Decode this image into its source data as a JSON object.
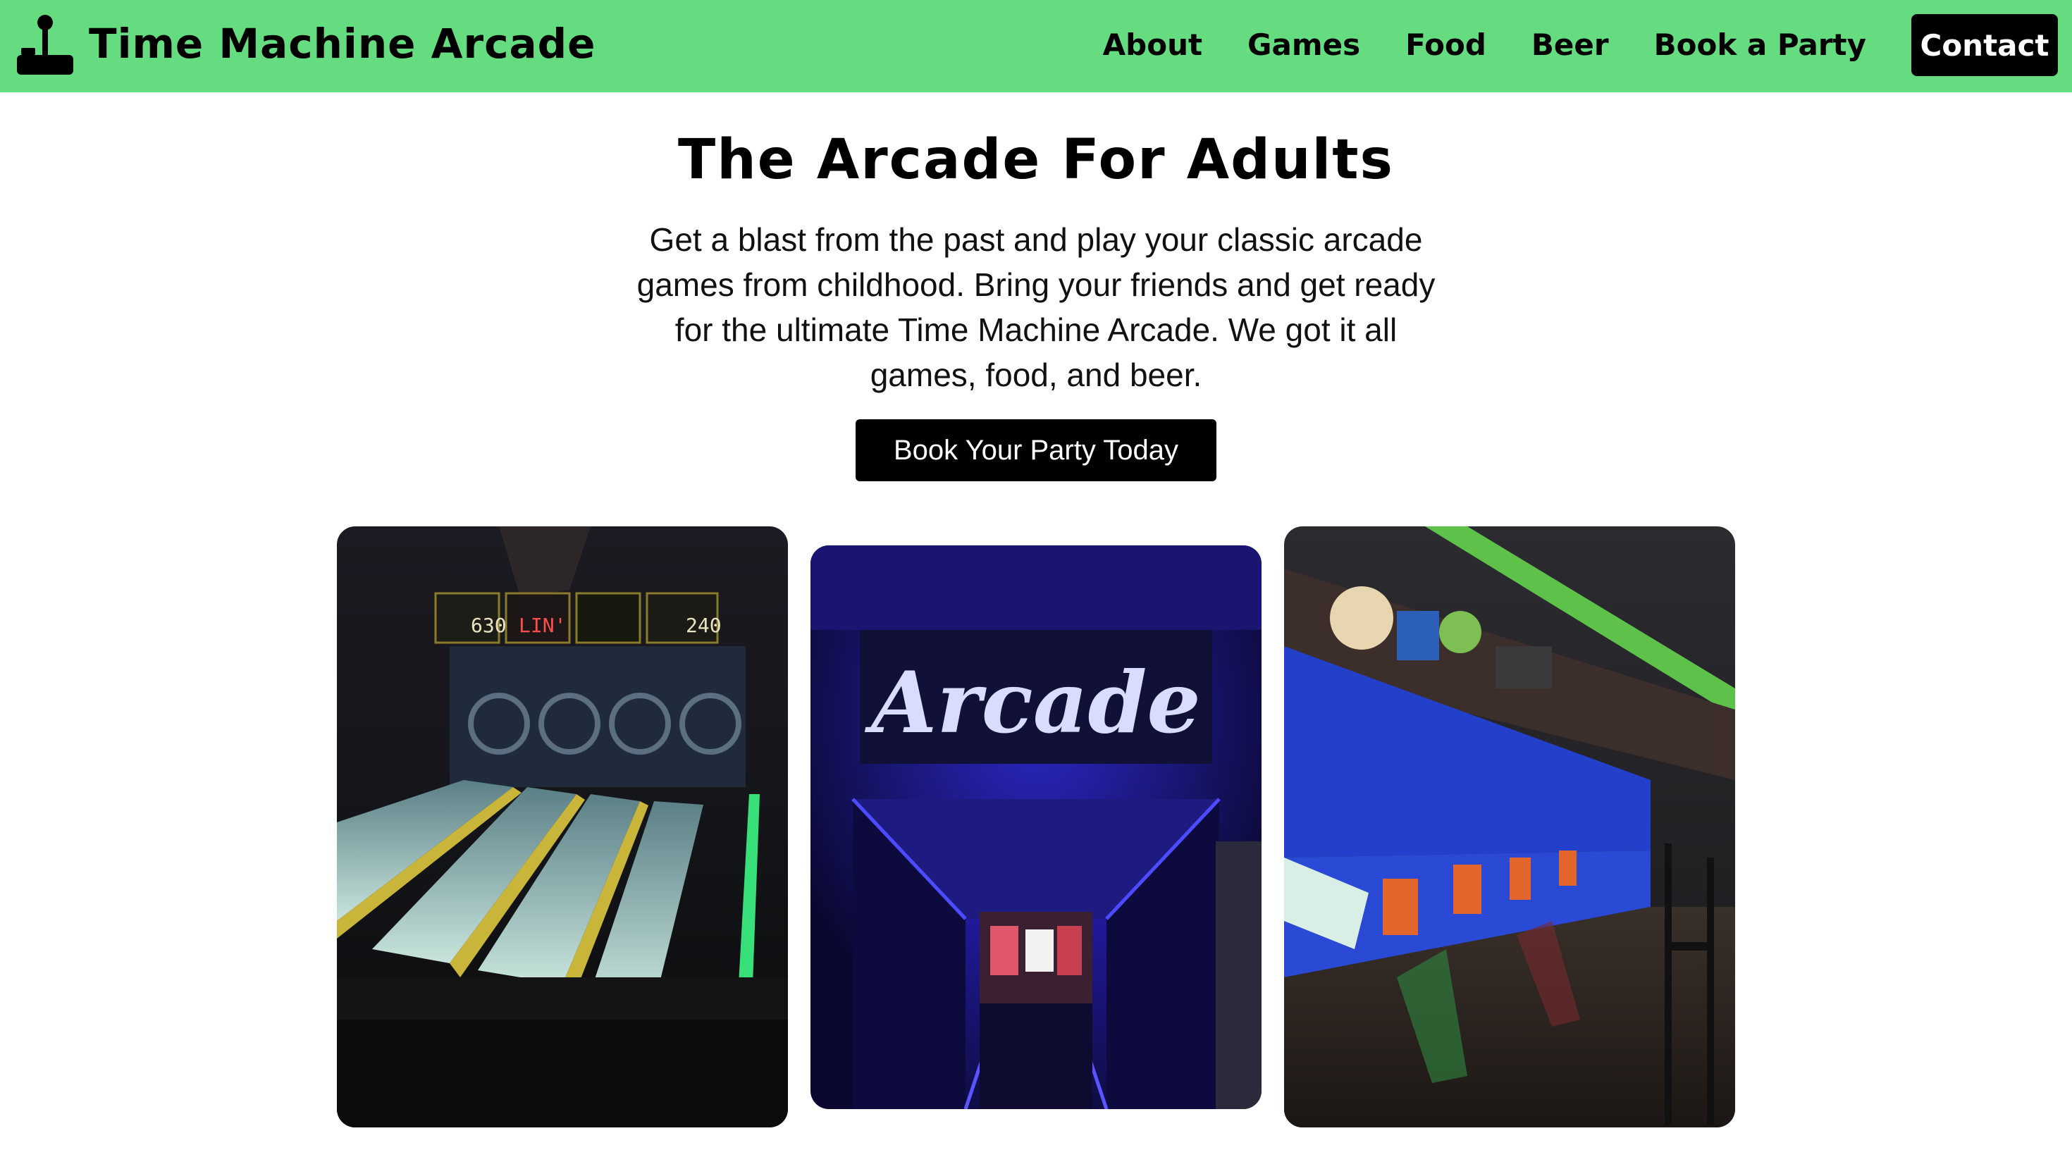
{
  "nav": {
    "brand": "Time Machine Arcade",
    "brand_icon": "joystick-icon",
    "links": [
      "About",
      "Games",
      "Food",
      "Beer",
      "Book a Party"
    ],
    "contact": "Contact"
  },
  "hero": {
    "title": "The Arcade For Adults",
    "text": "Get a blast from the past and play your classic arcade games from childhood. Bring your friends and get ready for the ultimate Time Machine Arcade. We got it all games, food, and beer.",
    "cta": "Book Your Party Today"
  },
  "gallery": {
    "sign_text": "Arcade",
    "score_boards": [
      "630",
      "LIN'",
      "",
      "240"
    ]
  },
  "colors": {
    "nav_bg": "#66dc80",
    "button_bg": "#000000",
    "button_text": "#ffffff"
  }
}
